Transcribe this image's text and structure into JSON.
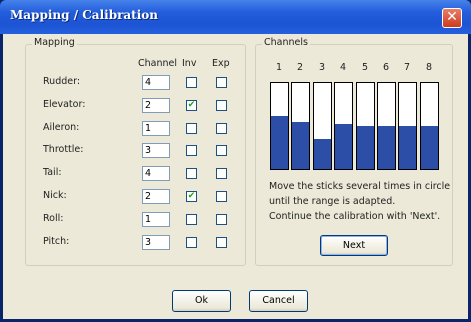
{
  "window": {
    "title": "Mapping / Calibration",
    "close_glyph": "✕"
  },
  "mapping": {
    "group_label": "Mapping",
    "headers": {
      "channel": "Channel",
      "inv": "Inv",
      "exp": "Exp"
    },
    "rows": [
      {
        "label": "Rudder:",
        "channel": "4",
        "inv": false,
        "exp": false
      },
      {
        "label": "Elevator:",
        "channel": "2",
        "inv": true,
        "exp": false
      },
      {
        "label": "Aileron:",
        "channel": "1",
        "inv": false,
        "exp": false
      },
      {
        "label": "Throttle:",
        "channel": "3",
        "inv": false,
        "exp": false
      },
      {
        "label": "Tail:",
        "channel": "4",
        "inv": false,
        "exp": false
      },
      {
        "label": "Nick:",
        "channel": "2",
        "inv": true,
        "exp": false
      },
      {
        "label": "Roll:",
        "channel": "1",
        "inv": false,
        "exp": false
      },
      {
        "label": "Pitch:",
        "channel": "3",
        "inv": false,
        "exp": false
      }
    ]
  },
  "channels": {
    "group_label": "Channels",
    "numbers": [
      "1",
      "2",
      "3",
      "4",
      "5",
      "6",
      "7",
      "8"
    ],
    "levels": [
      0.62,
      0.55,
      0.35,
      0.52,
      0.5,
      0.5,
      0.5,
      0.5
    ],
    "colors": {
      "fill": "#2d4ea6"
    },
    "instructions": [
      "Move the sticks several times in circle",
      "until the range is adapted.",
      "Continue the calibration with 'Next'."
    ],
    "next_label": "Next"
  },
  "footer": {
    "ok_label": "Ok",
    "cancel_label": "Cancel"
  },
  "check_glyph": "✔"
}
